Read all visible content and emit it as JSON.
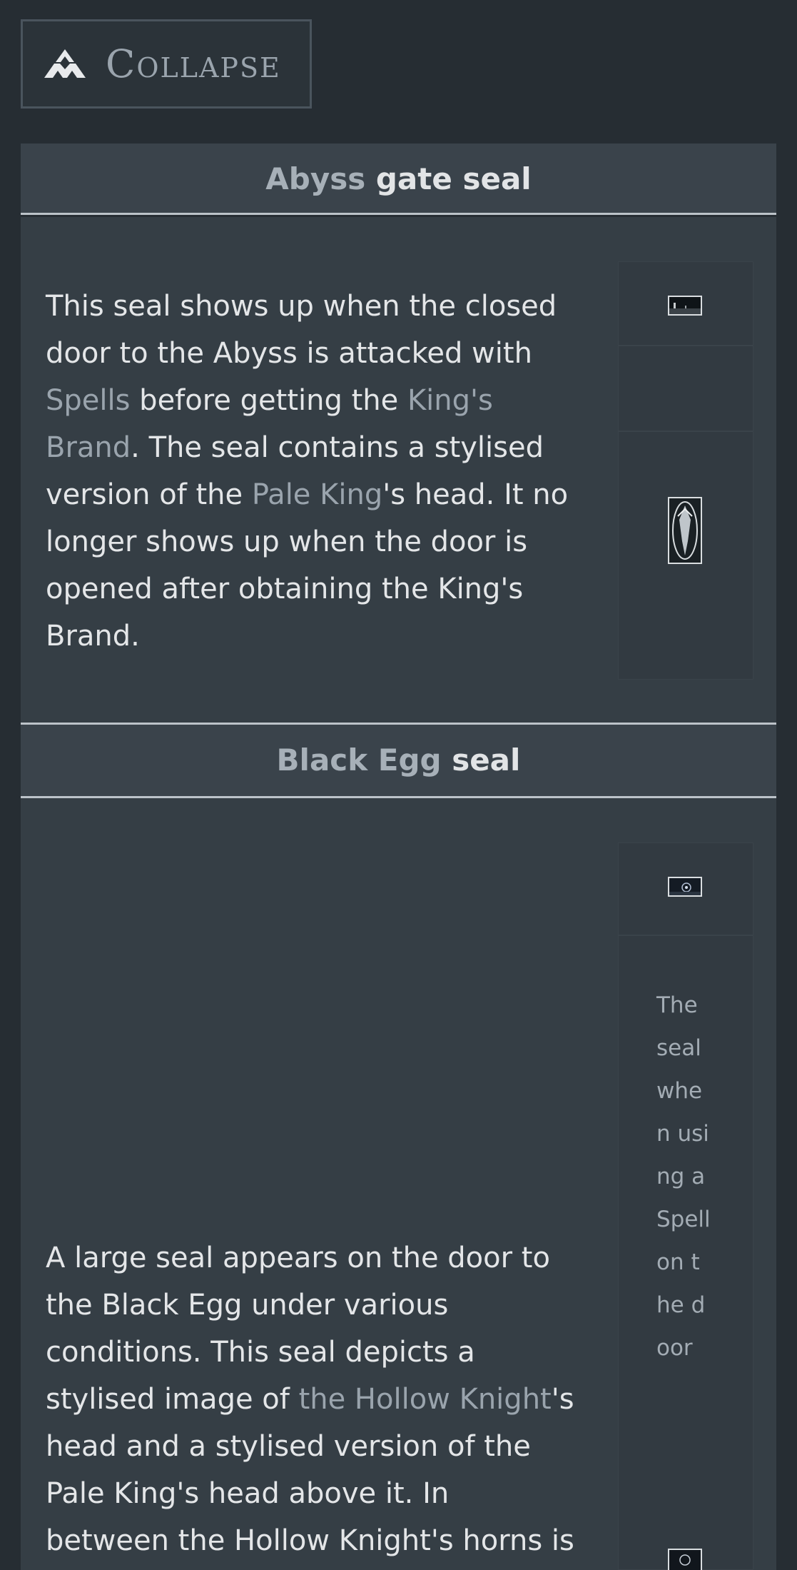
{
  "collapse": {
    "label": "Collapse",
    "icon": "crown-icon"
  },
  "sections": [
    {
      "title_link": "Abyss",
      "title_rest": " gate seal",
      "text": {
        "p1": "This seal shows up when the closed door to the Abyss is attacked with ",
        "link1": "Spells",
        "p2": " before getting the ",
        "link2": "King's Brand",
        "p3": ". The seal contains a stylised version of the ",
        "link3": "Pale King",
        "p4": "'s head. It no longer shows up when the door is opened after obtaining the King's Brand."
      }
    },
    {
      "title_link": "Black Egg",
      "title_rest": " seal",
      "text": {
        "p1": "A large seal appears on the door to the Black Egg under various conditions. This seal depicts a stylised image of ",
        "link1": "the Hollow Knight",
        "p2": "'s head and a stylised version of the Pale King's head above it. In between the Hollow Knight's horns is a sun-"
      },
      "caption": "The seal when using a Spell on the door"
    }
  ],
  "colors": {
    "background": "#262d33",
    "panel": "#353e45",
    "header": "#3a434b",
    "link": "#9aa4ad",
    "text": "#e4e6e8"
  }
}
